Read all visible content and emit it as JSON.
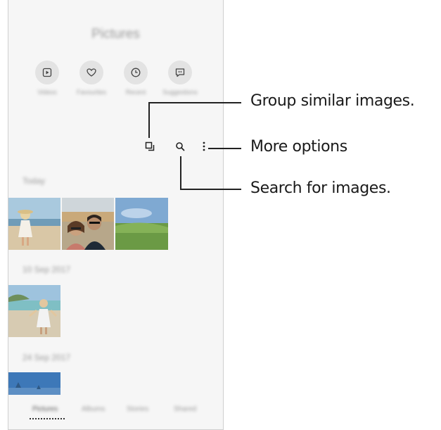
{
  "app": {
    "title": "Pictures"
  },
  "shortcuts": [
    {
      "label": "Videos",
      "icon": "video-icon"
    },
    {
      "label": "Favourites",
      "icon": "heart-icon"
    },
    {
      "label": "Recent",
      "icon": "clock-icon"
    },
    {
      "label": "Suggestions",
      "icon": "suggestions-icon"
    }
  ],
  "toolbar": {
    "group_icon": "group-similar-icon",
    "search_icon": "search-icon",
    "more_icon": "more-options-icon"
  },
  "sections": [
    {
      "heading": "Today"
    },
    {
      "heading": "10 Sep 2017"
    },
    {
      "heading": "24 Sep 2017"
    }
  ],
  "tabs": [
    "Pictures",
    "Albums",
    "Stories",
    "Shared"
  ],
  "callouts": {
    "group": "Group similar images.",
    "more": "More options",
    "search": "Search for images."
  }
}
